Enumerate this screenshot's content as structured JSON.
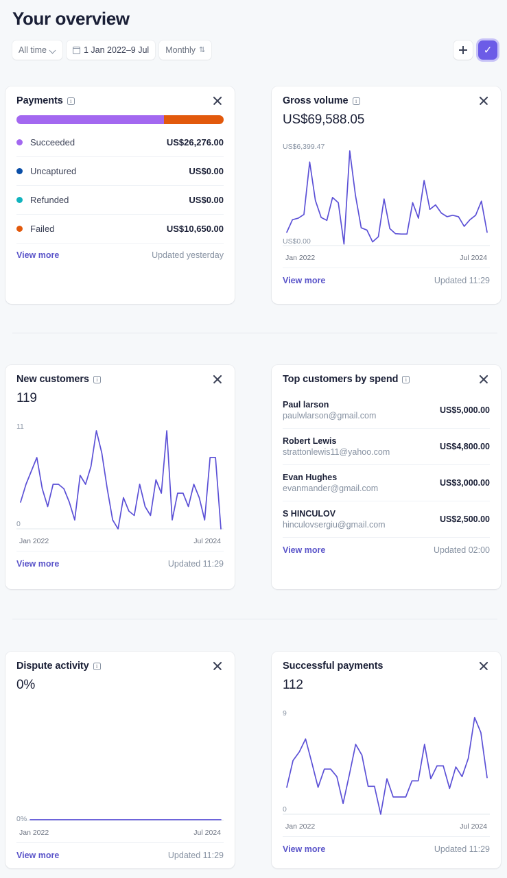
{
  "header": {
    "title": "Your overview",
    "filters": [
      {
        "label": "All time",
        "icon": "chevron-down-icon"
      },
      {
        "label": "1 Jan 2022–9 Jul",
        "icon": "calendar-icon"
      },
      {
        "label": "Monthly",
        "icon": "chevron-updown-icon"
      }
    ],
    "add_button": "+",
    "confirm_button": "✓"
  },
  "colors": {
    "accent": "#6C5CE7",
    "link": "#5A54C9",
    "succeeded": "#A368F0",
    "uncaptured": "#0B4FA8",
    "refunded": "#11B3BE",
    "failed": "#E2590C",
    "chart_line": "#5B50D6",
    "page_bg": "#F6F8FA"
  },
  "cards": {
    "payments": {
      "title": "Payments",
      "info": "i",
      "bar": [
        {
          "name": "Succeeded",
          "pct": 71.2,
          "color": "#A368F0"
        },
        {
          "name": "Failed",
          "pct": 28.8,
          "color": "#E2590C"
        }
      ],
      "rows": [
        {
          "label": "Succeeded",
          "amount": "US$26,276.00",
          "color": "#A368F0"
        },
        {
          "label": "Uncaptured",
          "amount": "US$0.00",
          "color": "#0B4FA8"
        },
        {
          "label": "Refunded",
          "amount": "US$0.00",
          "color": "#11B3BE"
        },
        {
          "label": "Failed",
          "amount": "US$10,650.00",
          "color": "#E2590C"
        }
      ],
      "view_more": "View more",
      "updated": "Updated yesterday"
    },
    "gross_volume": {
      "title": "Gross volume",
      "info": "i",
      "value": "US$69,588.05",
      "view_more": "View more",
      "updated": "Updated 11:29"
    },
    "new_customers": {
      "title": "New customers",
      "info": "i",
      "value": "119",
      "view_more": "View more",
      "updated": "Updated 11:29"
    },
    "top_customers": {
      "title": "Top customers by spend",
      "info": "i",
      "rows": [
        {
          "name": "Paul larson",
          "email": "paulwlarson@gmail.com",
          "amount": "US$5,000.00"
        },
        {
          "name": "Robert Lewis",
          "email": "strattonlewis11@yahoo.com",
          "amount": "US$4,800.00"
        },
        {
          "name": "Evan Hughes",
          "email": "evanmander@gmail.com",
          "amount": "US$3,000.00"
        },
        {
          "name": "S HINCULOV",
          "email": "hinculovsergiu@gmail.com",
          "amount": "US$2,500.00"
        }
      ],
      "view_more": "View more",
      "updated": "Updated 02:00"
    },
    "dispute_activity": {
      "title": "Dispute activity",
      "info": "i",
      "value": "0%",
      "view_more": "View more",
      "updated": "Updated 11:29"
    },
    "successful_payments": {
      "title": "Successful payments",
      "value": "112",
      "view_more": "View more",
      "updated": "Updated 11:29"
    }
  },
  "chart_data": [
    {
      "id": "gross_volume",
      "type": "line",
      "title": "Gross volume",
      "ylabel": "",
      "xlabel": "",
      "ymax_label": "US$6,399.47",
      "ymin_label": "US$0.00",
      "ylim": [
        0,
        6399.47
      ],
      "x_ticks": [
        "Jan 2022",
        "Jul 2024"
      ],
      "grid": false,
      "legend": "none",
      "values": [
        900,
        1750,
        1850,
        2100,
        5650,
        3050,
        1900,
        1700,
        3250,
        2900,
        100,
        6400,
        3400,
        1200,
        1050,
        250,
        600,
        3150,
        1150,
        800,
        780,
        780,
        2900,
        1850,
        4400,
        2450,
        2750,
        2200,
        1950,
        2050,
        1950,
        1300,
        1750,
        2050,
        3000,
        900
      ]
    },
    {
      "id": "new_customers",
      "type": "line",
      "title": "New customers",
      "ymax_label": "11",
      "ymin_label": "0",
      "ylim": [
        0,
        11
      ],
      "x_ticks": [
        "Jan 2022",
        "Jul 2024"
      ],
      "grid": false,
      "legend": "none",
      "values": [
        3,
        5,
        6.5,
        8,
        4.5,
        2.5,
        5,
        5,
        4.5,
        3,
        1,
        6,
        5,
        7,
        11,
        8.5,
        4.5,
        1,
        0,
        3.5,
        2,
        1.5,
        5,
        2.5,
        1.5,
        5.5,
        4,
        11,
        1,
        4,
        4,
        2.5,
        5,
        3.5,
        1,
        8,
        8,
        0
      ]
    },
    {
      "id": "dispute_activity",
      "type": "line",
      "title": "Dispute activity",
      "ymax_label": "",
      "ymin_label": "0%",
      "ylim": [
        0,
        1
      ],
      "x_ticks": [
        "Jan 2022",
        "Jul 2024"
      ],
      "grid": false,
      "legend": "none",
      "values": [
        0,
        0,
        0,
        0,
        0,
        0,
        0,
        0,
        0,
        0,
        0,
        0,
        0,
        0,
        0,
        0,
        0,
        0,
        0,
        0,
        0,
        0
      ]
    },
    {
      "id": "successful_payments",
      "type": "line",
      "title": "Successful payments",
      "ymax_label": "9",
      "ymin_label": "0",
      "ylim": [
        0,
        9
      ],
      "x_ticks": [
        "Jan 2022",
        "Jul 2024"
      ],
      "grid": false,
      "legend": "none",
      "values": [
        2.5,
        5,
        5.8,
        7,
        4.8,
        2.5,
        4.2,
        4.2,
        3.5,
        1,
        3.7,
        6.5,
        5.5,
        2.6,
        2.6,
        0,
        3.3,
        1.6,
        1.6,
        1.6,
        3.1,
        3.1,
        6.5,
        3.3,
        4.5,
        4.5,
        2.4,
        4.4,
        3.5,
        5.2,
        9,
        7.6,
        3.4
      ]
    }
  ]
}
